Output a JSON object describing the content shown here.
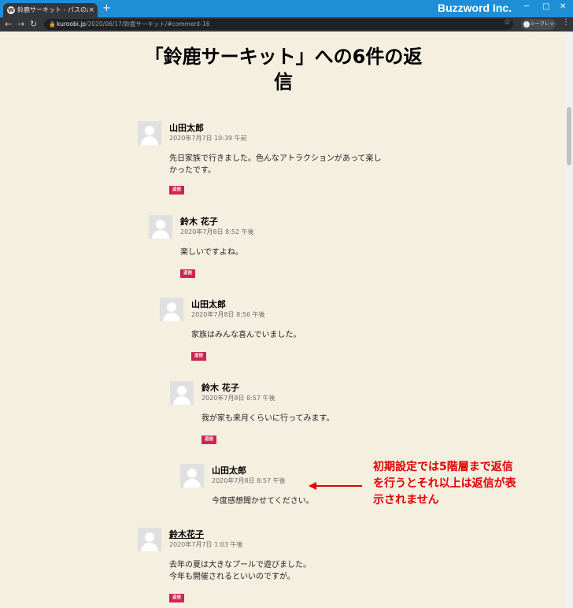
{
  "browser": {
    "tab_title": "鈴鹿サーキット - パスのおでかけブログ",
    "tab_close": "×",
    "new_tab": "+",
    "url_host": "kuroobi.jp",
    "url_path": "/2020/06/17/鈴鹿サーキット/#comment-16",
    "brand": "Buzzword Inc.",
    "incognito_label": "シークレット",
    "win_min": "─",
    "win_max": "□",
    "win_close": "✕"
  },
  "page": {
    "title_line1": "「鈴鹿サーキット」への6件の返",
    "title_line2": "信"
  },
  "reply_label": "返信",
  "comments": [
    {
      "author": "山田太郎",
      "date": "2020年7月7日 10:39 午前",
      "lines": [
        "先日家族で行きました。色んなアトラクションがあって楽し",
        "かったです。"
      ],
      "has_reply": true
    },
    {
      "author": "鈴木 花子",
      "date": "2020年7月8日 8:52 午後",
      "lines": [
        "楽しいですよね。"
      ],
      "has_reply": true
    },
    {
      "author": "山田太郎",
      "date": "2020年7月8日 8:56 午後",
      "lines": [
        "家族はみんな喜んでいました。"
      ],
      "has_reply": true
    },
    {
      "author": "鈴木 花子",
      "date": "2020年7月8日 8:57 午後",
      "lines": [
        "我が家も来月くらいに行ってみます。"
      ],
      "has_reply": true
    },
    {
      "author": "山田太郎",
      "date": "2020年7月8日 8:57 午後",
      "lines": [
        "今度感想聞かせてください。"
      ],
      "has_reply": false
    },
    {
      "author": "鈴木花子",
      "date": "2020年7月7日 1:03 午後",
      "lines": [
        "去年の夏は大きなプールで遊びました。",
        "今年も開催されるといいのですが。"
      ],
      "has_reply": true
    }
  ],
  "annotation": {
    "line1": "初期設定では5階層まで返信",
    "line2": "を行うとそれ以上は返信が表",
    "line3": "示されません",
    "color": "#e00000"
  }
}
